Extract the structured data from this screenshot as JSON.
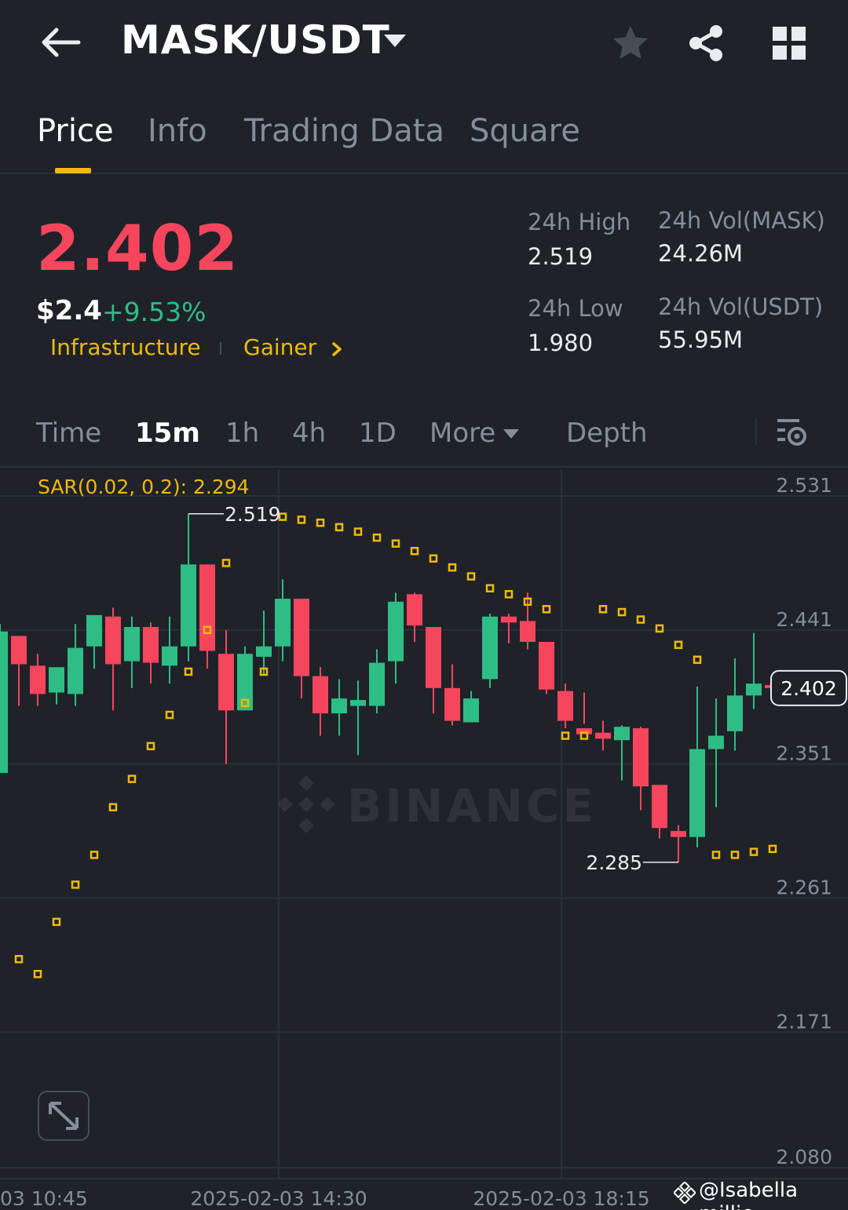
{
  "header": {
    "pair": "MASK/USDT",
    "icons": [
      "back-arrow-icon",
      "chevron-down-icon",
      "star-icon",
      "share-icon",
      "grid-icon"
    ]
  },
  "tabs": [
    {
      "label": "Price",
      "active": true
    },
    {
      "label": "Info",
      "active": false
    },
    {
      "label": "Trading Data",
      "active": false
    },
    {
      "label": "Square",
      "active": false
    }
  ],
  "price": {
    "last": "2.402",
    "usd": "$2.4",
    "change_pct": "+9.53%",
    "tags": [
      "Infrastructure",
      "Gainer"
    ]
  },
  "stats": {
    "high_label": "24h High",
    "high_value": "2.519",
    "low_label": "24h Low",
    "low_value": "1.980",
    "vol_mask_label": "24h Vol(MASK)",
    "vol_mask_value": "24.26M",
    "vol_usdt_label": "24h Vol(USDT)",
    "vol_usdt_value": "55.95M"
  },
  "intervals": {
    "items": [
      "Time",
      "15m",
      "1h",
      "4h",
      "1D",
      "More",
      "Depth"
    ],
    "active": "15m"
  },
  "indicator": "SAR(0.02, 0.2): 2.294",
  "watermark": "BINANCE",
  "credit": "@Isabella millie",
  "colors": {
    "up": "#2ebd85",
    "down": "#f6465d",
    "accent": "#f0b90b",
    "bg": "#1f2229"
  },
  "chart_data": {
    "type": "candlestick",
    "y_ticks": [
      "2.531",
      "2.441",
      "2.351",
      "2.261",
      "2.171",
      "2.080"
    ],
    "ylim": [
      2.08,
      2.531
    ],
    "x_ticks": [
      "03 10:45",
      "2025-02-03 14:30",
      "2025-02-03 18:15"
    ],
    "max_label": "2.519",
    "min_label": "2.285",
    "current_price": "2.402",
    "candles": [
      {
        "o": 2.345,
        "h": 2.445,
        "l": 2.345,
        "c": 2.44
      },
      {
        "o": 2.437,
        "h": 2.437,
        "l": 2.39,
        "c": 2.418
      },
      {
        "o": 2.417,
        "h": 2.425,
        "l": 2.39,
        "c": 2.398
      },
      {
        "o": 2.399,
        "h": 2.415,
        "l": 2.391,
        "c": 2.416
      },
      {
        "o": 2.398,
        "h": 2.445,
        "l": 2.39,
        "c": 2.429
      },
      {
        "o": 2.43,
        "h": 2.451,
        "l": 2.415,
        "c": 2.451
      },
      {
        "o": 2.45,
        "h": 2.456,
        "l": 2.387,
        "c": 2.418
      },
      {
        "o": 2.42,
        "h": 2.45,
        "l": 2.402,
        "c": 2.443
      },
      {
        "o": 2.443,
        "h": 2.446,
        "l": 2.405,
        "c": 2.419
      },
      {
        "o": 2.417,
        "h": 2.45,
        "l": 2.405,
        "c": 2.43
      },
      {
        "o": 2.43,
        "h": 2.519,
        "l": 2.42,
        "c": 2.485
      },
      {
        "o": 2.485,
        "h": 2.485,
        "l": 2.415,
        "c": 2.427
      },
      {
        "o": 2.425,
        "h": 2.441,
        "l": 2.351,
        "c": 2.387
      },
      {
        "o": 2.387,
        "h": 2.43,
        "l": 2.387,
        "c": 2.425
      },
      {
        "o": 2.423,
        "h": 2.454,
        "l": 2.411,
        "c": 2.43
      },
      {
        "o": 2.43,
        "h": 2.475,
        "l": 2.42,
        "c": 2.462
      },
      {
        "o": 2.462,
        "h": 2.462,
        "l": 2.395,
        "c": 2.41
      },
      {
        "o": 2.41,
        "h": 2.416,
        "l": 2.37,
        "c": 2.385
      },
      {
        "o": 2.385,
        "h": 2.408,
        "l": 2.37,
        "c": 2.395
      },
      {
        "o": 2.39,
        "h": 2.407,
        "l": 2.357,
        "c": 2.394
      },
      {
        "o": 2.39,
        "h": 2.428,
        "l": 2.385,
        "c": 2.419
      },
      {
        "o": 2.42,
        "h": 2.466,
        "l": 2.405,
        "c": 2.46
      },
      {
        "o": 2.465,
        "h": 2.466,
        "l": 2.433,
        "c": 2.444
      },
      {
        "o": 2.443,
        "h": 2.443,
        "l": 2.385,
        "c": 2.402
      },
      {
        "o": 2.402,
        "h": 2.418,
        "l": 2.377,
        "c": 2.38
      },
      {
        "o": 2.379,
        "h": 2.4,
        "l": 2.38,
        "c": 2.395
      },
      {
        "o": 2.408,
        "h": 2.452,
        "l": 2.402,
        "c": 2.45
      },
      {
        "o": 2.45,
        "h": 2.452,
        "l": 2.432,
        "c": 2.446
      },
      {
        "o": 2.447,
        "h": 2.466,
        "l": 2.428,
        "c": 2.433
      },
      {
        "o": 2.433,
        "h": 2.433,
        "l": 2.398,
        "c": 2.401
      },
      {
        "o": 2.4,
        "h": 2.405,
        "l": 2.375,
        "c": 2.38
      },
      {
        "o": 2.375,
        "h": 2.399,
        "l": 2.378,
        "c": 2.371
      },
      {
        "o": 2.372,
        "h": 2.38,
        "l": 2.36,
        "c": 2.368
      },
      {
        "o": 2.367,
        "h": 2.377,
        "l": 2.34,
        "c": 2.376
      },
      {
        "o": 2.375,
        "h": 2.376,
        "l": 2.32,
        "c": 2.336
      },
      {
        "o": 2.337,
        "h": 2.337,
        "l": 2.301,
        "c": 2.308
      },
      {
        "o": 2.306,
        "h": 2.31,
        "l": 2.285,
        "c": 2.302
      },
      {
        "o": 2.302,
        "h": 2.403,
        "l": 2.295,
        "c": 2.361
      },
      {
        "o": 2.361,
        "h": 2.395,
        "l": 2.322,
        "c": 2.37
      },
      {
        "o": 2.373,
        "h": 2.422,
        "l": 2.36,
        "c": 2.397
      },
      {
        "o": 2.397,
        "h": 2.439,
        "l": 2.388,
        "c": 2.405
      },
      {
        "o": 2.404,
        "h": 2.407,
        "l": 2.401,
        "c": 2.402
      }
    ],
    "sar": [
      null,
      2.22,
      2.21,
      2.245,
      2.27,
      2.29,
      2.322,
      2.341,
      2.363,
      2.384,
      2.413,
      2.441,
      2.486,
      2.392,
      2.413,
      2.517,
      2.515,
      2.513,
      2.51,
      2.507,
      2.503,
      2.499,
      2.494,
      2.489,
      2.483,
      2.477,
      2.469,
      2.465,
      2.46,
      2.455,
      2.37,
      2.37,
      2.455,
      2.453,
      2.448,
      2.442,
      2.431,
      2.421,
      2.29,
      2.29,
      2.292,
      2.294
    ]
  }
}
